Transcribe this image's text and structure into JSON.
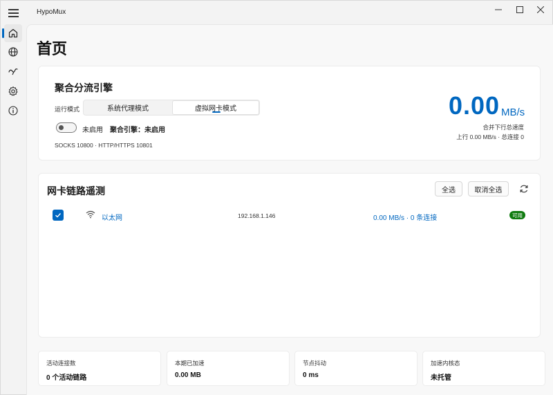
{
  "app": {
    "title": "HypoMux"
  },
  "window_controls": {
    "minimize_icon": "minimize-icon",
    "maximize_icon": "maximize-icon",
    "close_icon": "close-icon"
  },
  "sidebar": {
    "items": [
      {
        "icon": "home-icon",
        "active": true
      },
      {
        "icon": "globe-icon",
        "active": false
      },
      {
        "icon": "speedometer-icon",
        "active": false
      },
      {
        "icon": "gear-icon",
        "active": false
      },
      {
        "icon": "info-icon",
        "active": false
      }
    ]
  },
  "page": {
    "title": "首页"
  },
  "engine": {
    "title": "聚合分流引擎",
    "mode_label": "运行模式",
    "modes": [
      "系统代理模式",
      "虚拟网卡模式"
    ],
    "selected_mode": "虚拟网卡模式",
    "toggle_state": false,
    "toggle_label": "未启用",
    "engine_status": "聚合引擎：未启用",
    "ports": "SOCKS 10800 · HTTP/HTTPS 10801",
    "speed_value": "0.00",
    "speed_unit": "MB/s",
    "speed_caption": "合并下行总速度",
    "speed_sub": "上行 0.00 MB/s · 总连接 0"
  },
  "links": {
    "title": "网卡链路遥测",
    "select_all": "全选",
    "deselect_all": "取消全选",
    "refresh_icon": "refresh-icon",
    "rows": [
      {
        "checked": true,
        "icon": "wifi-icon",
        "name": "以太网",
        "ip": "192.168.1.146",
        "traffic": "0.00 MB/s · 0 条连接",
        "status": "可用"
      }
    ]
  },
  "stats": [
    {
      "label": "活动连接数",
      "value": "0 个活动链路"
    },
    {
      "label": "本期已加速",
      "value": "0.00 MB"
    },
    {
      "label": "节点抖动",
      "value": "0 ms"
    },
    {
      "label": "加速内核态",
      "value": "未托管"
    }
  ],
  "colors": {
    "accent": "#0067c0",
    "badge_green": "#0f7b0f"
  }
}
